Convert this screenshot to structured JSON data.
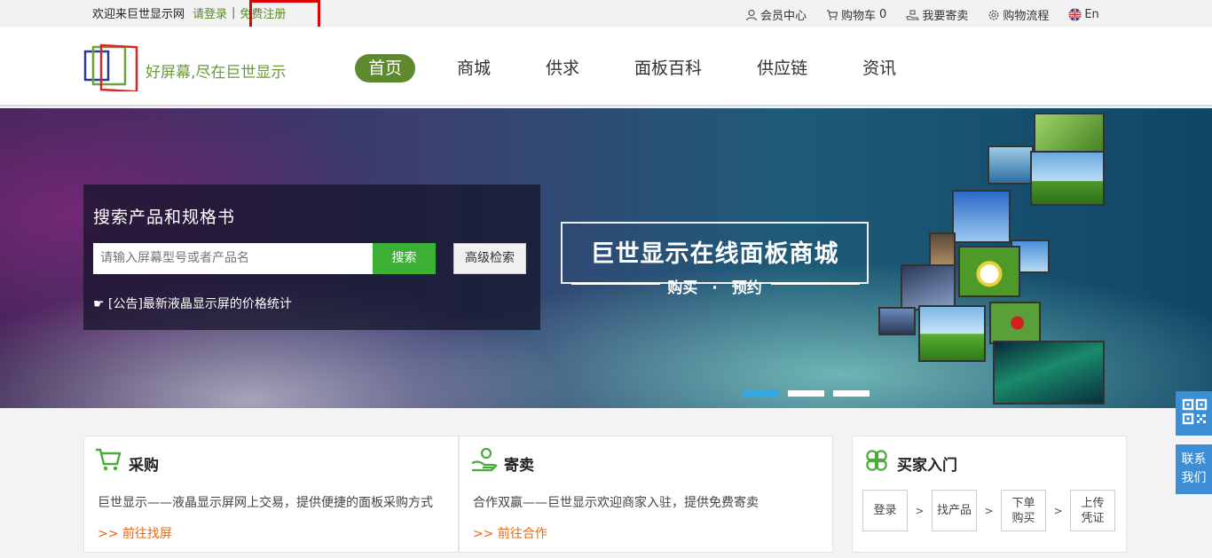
{
  "topbar": {
    "welcome": "欢迎来巨世显示网",
    "login": "请登录",
    "separator": "|",
    "register": "免费注册",
    "member_center": "会员中心",
    "cart_label": "购物车",
    "cart_count": "0",
    "consign": "我要寄卖",
    "process": "购物流程",
    "language": "En"
  },
  "header": {
    "slogan": "好屏幕,尽在巨世显示",
    "nav": [
      "首页",
      "商城",
      "供求",
      "面板百科",
      "供应链",
      "资讯"
    ]
  },
  "search": {
    "title": "搜索产品和规格书",
    "placeholder": "请输入屏幕型号或者产品名",
    "button": "搜索",
    "advanced": "高级检索",
    "notice": "☛ [公告]最新液晶显示屏的价格统计"
  },
  "banner": {
    "headline": "巨世显示在线面板商城",
    "sub_left": "购买",
    "sub_dot": "·",
    "sub_right": "预约",
    "active_slide": 1,
    "slide_count": 3
  },
  "side": {
    "contact": "联系我们"
  },
  "cards": {
    "purchase": {
      "title": "采购",
      "desc": "巨世显示——液晶显示屏网上交易，提供便捷的面板采购方式",
      "link": ">> 前往找屏"
    },
    "consign": {
      "title": "寄卖",
      "desc": "合作双赢——巨世显示欢迎商家入驻，提供免费寄卖",
      "link": ">> 前往合作"
    },
    "buyer": {
      "title": "买家入门",
      "steps": [
        "登录",
        "找产品",
        "下单购买",
        "上传凭证"
      ],
      "arrow": ">"
    }
  },
  "colors": {
    "brand_green": "#5e8a2e",
    "search_green": "#3cb034",
    "link_orange": "#e86a10",
    "side_blue": "#3c8fd6",
    "highlight_red": "#e00000"
  }
}
